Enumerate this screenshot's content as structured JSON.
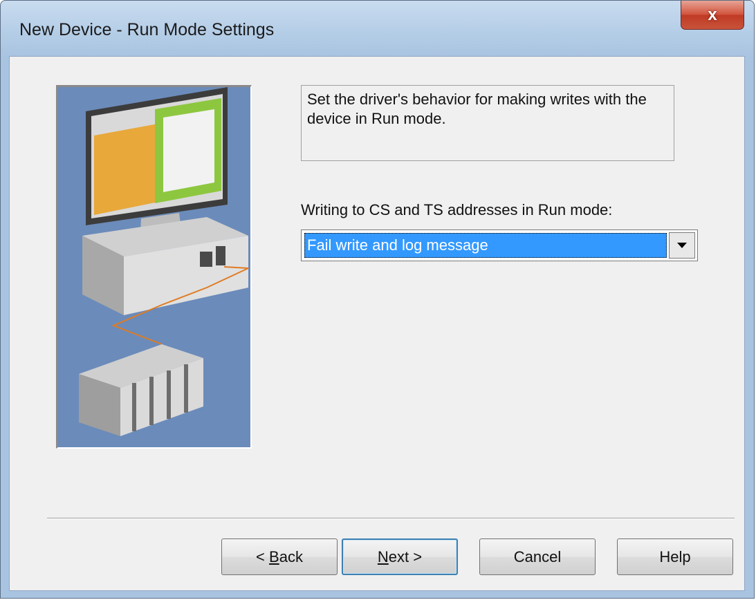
{
  "window": {
    "title": "New Device - Run Mode Settings",
    "close_glyph": "x"
  },
  "description": "Set the driver's behavior for making writes with the device in Run mode.",
  "illustration": {
    "subject": "computer-connected-to-plc-icon"
  },
  "field": {
    "label": "Writing to CS and TS addresses in Run mode:",
    "selected_value": "Fail write and log message"
  },
  "buttons": {
    "back": {
      "prefix": "< ",
      "mnemonic": "B",
      "rest": "ack"
    },
    "next": {
      "mnemonic": "N",
      "rest": "ext >"
    },
    "cancel": "Cancel",
    "help": "Help"
  },
  "colors": {
    "selection": "#3399ff",
    "illustration_background": "#6b8cba",
    "close_button": "#c8533a"
  }
}
